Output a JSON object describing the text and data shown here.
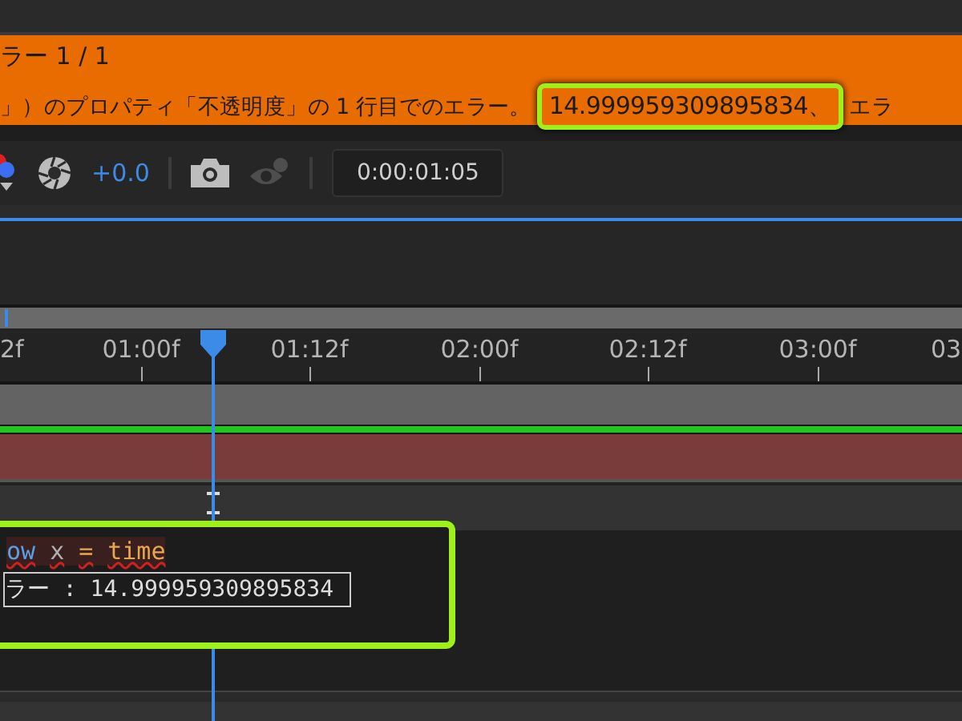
{
  "error_bar": {
    "title": "ラー 1 / 1",
    "message": "」）のプロパティ「不透明度」の 1 行目でのエラー。",
    "value": "14.999959309895834、",
    "trailing": "エラ"
  },
  "toolbar": {
    "exposure": "+0.0",
    "show_snapshot_disabled": true,
    "timecode": "0:00:01:05"
  },
  "timeline": {
    "ruler_labels": [
      "2f",
      "01:00f",
      "01:12f",
      "02:00f",
      "02:12f",
      "03:00f",
      "03"
    ]
  },
  "expression": {
    "tokens": [
      {
        "text": "ow",
        "kind": "keyword"
      },
      {
        "text": "x",
        "kind": "identifier"
      },
      {
        "text": "=",
        "kind": "operator"
      },
      {
        "text": "time",
        "kind": "builtin"
      }
    ],
    "error": "ラー : 14.999959309895834"
  }
}
